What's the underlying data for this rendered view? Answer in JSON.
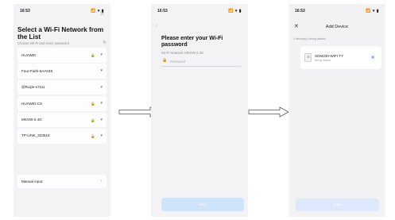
{
  "screen1": {
    "time": "16:53",
    "status_icons": "📶 ▾ ▮",
    "close_label": "✕",
    "title": "Select a Wi-Fi Network from the List",
    "search_hint": "Choose Wi-Fi and enter password",
    "refresh_glyph": "↻",
    "networks": [
      {
        "name": "HUAWEI",
        "locked": true
      },
      {
        "name": "Four-Faith-5AA048",
        "locked": false
      },
      {
        "name": "@Ruijie-s7111",
        "locked": false
      },
      {
        "name": "HUAWEI-CS",
        "locked": true
      },
      {
        "name": "MKSW-2.4G",
        "locked": true
      },
      {
        "name": "TP-LINK_323518",
        "locked": true
      }
    ],
    "lock_glyph": "🔒",
    "signal_glyph": "▾",
    "manual_input": "Manual input",
    "chevron": "›"
  },
  "screen2": {
    "time": "16:53",
    "status_icons": "📶 ▾ ▮",
    "back_label": "‹",
    "title": "Please enter your Wi-Fi password",
    "network_line": "Wi-Fi Network: MKSW-2.4G",
    "password_placeholder": "Password",
    "lock_glyph": "🔒",
    "next_label": "Next"
  },
  "screen3": {
    "time": "16:53",
    "status_icons": "📶 ▾ ▮",
    "close_label": "✕",
    "title": "Add Device",
    "count_line": "1 device(s) being added",
    "device_name": "SDM230-WIFI TY",
    "device_status": "Being added",
    "done_label": "Done"
  },
  "colors": {
    "primary_light": "#cfe3fb",
    "accent": "#3d82e6"
  }
}
